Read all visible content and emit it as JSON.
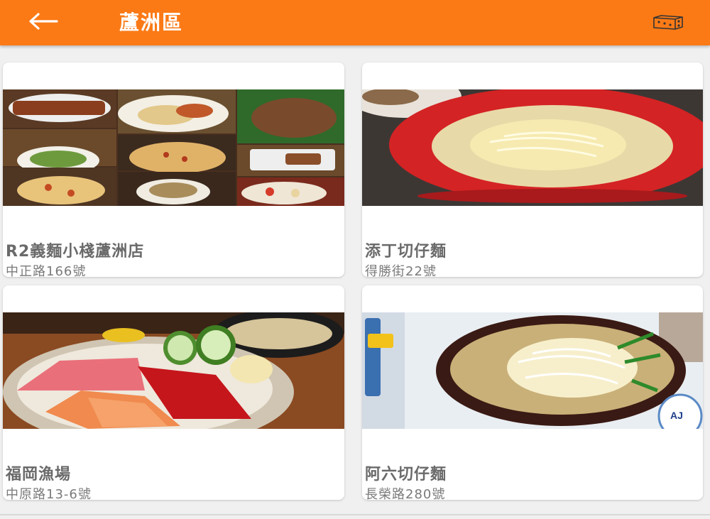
{
  "header": {
    "title": "蘆洲區",
    "back_icon": "arrow-left-icon",
    "action_icon": "dice-icon"
  },
  "restaurants": [
    {
      "name": "R2義麵小棧蘆洲店",
      "address": "中正路166號",
      "photo": "pasta-pizza-collage"
    },
    {
      "name": "添丁切仔麵",
      "address": "得勝街22號",
      "photo": "noodle-soup-red-bowl"
    },
    {
      "name": "福岡漁場",
      "address": "中原路13-6號",
      "photo": "sashimi-bowl"
    },
    {
      "name": "阿六切仔麵",
      "address": "長榮路280號",
      "photo": "noodle-soup-bean-sprouts"
    }
  ],
  "colors": {
    "accent": "#fb7a16",
    "background": "#f0f0f0",
    "card": "#ffffff"
  }
}
